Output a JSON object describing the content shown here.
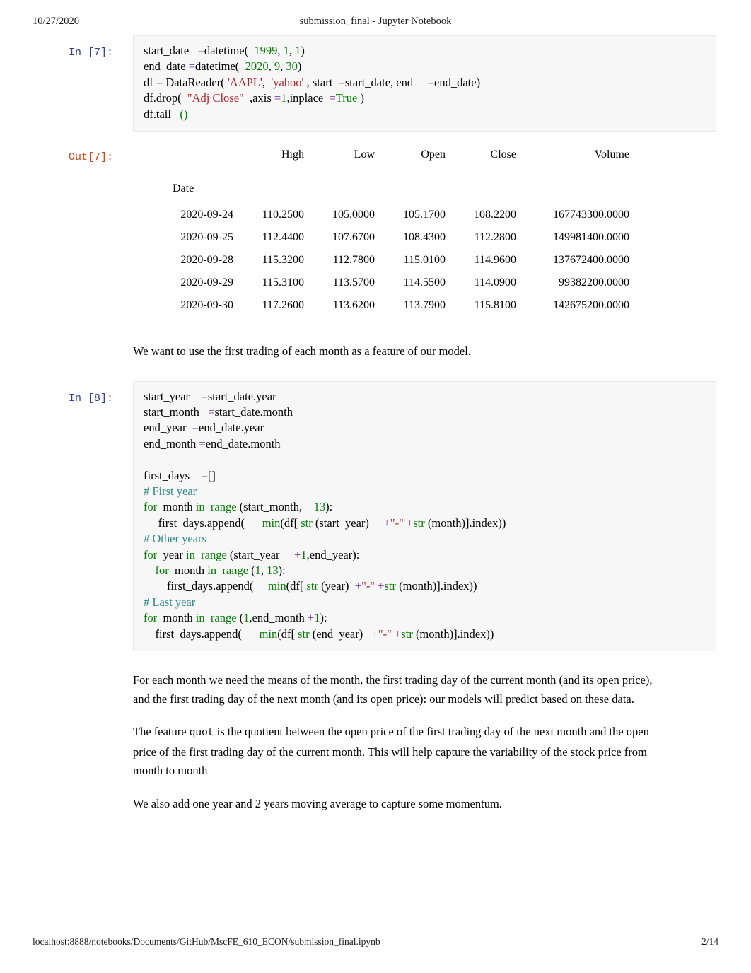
{
  "header": {
    "date": "10/27/2020",
    "title": "submission_final - Jupyter Notebook"
  },
  "footer": {
    "url": "localhost:8888/notebooks/Documents/GitHub/MscFE_610_ECON/submission_final.ipynb",
    "page": "2/14"
  },
  "colors": {
    "prompt_in": "#303f9f",
    "prompt_out": "#d84315",
    "keyword": "#008000",
    "string": "#ba2121",
    "number": "#008000",
    "operator": "#7a3fa0",
    "comment": "#2e8b8b",
    "cell_background": "#f7f7f7",
    "cell_border": "#e7e7e7"
  },
  "cells": [
    {
      "prompt": "In [7]:",
      "type": "code",
      "lines": [
        [
          {
            "t": "start_date",
            "c": "n"
          },
          {
            "t": "   ",
            "c": "n"
          },
          {
            "t": "=",
            "c": "op"
          },
          {
            "t": "datetime(",
            "c": "n"
          },
          {
            "t": "  ",
            "c": "n"
          },
          {
            "t": "1999",
            "c": "m"
          },
          {
            "t": ", ",
            "c": "n"
          },
          {
            "t": "1",
            "c": "m"
          },
          {
            "t": ", ",
            "c": "n"
          },
          {
            "t": "1",
            "c": "m"
          },
          {
            "t": ")",
            "c": "n"
          }
        ],
        [
          {
            "t": "end_date ",
            "c": "n"
          },
          {
            "t": "=",
            "c": "op"
          },
          {
            "t": "datetime(",
            "c": "n"
          },
          {
            "t": "  ",
            "c": "n"
          },
          {
            "t": "2020",
            "c": "m"
          },
          {
            "t": ", ",
            "c": "n"
          },
          {
            "t": "9",
            "c": "m"
          },
          {
            "t": ", ",
            "c": "n"
          },
          {
            "t": "30",
            "c": "m"
          },
          {
            "t": ")",
            "c": "n"
          }
        ],
        [
          {
            "t": "df ",
            "c": "n"
          },
          {
            "t": "=",
            "c": "op"
          },
          {
            "t": " DataReader( ",
            "c": "n"
          },
          {
            "t": "'AAPL'",
            "c": "s"
          },
          {
            "t": ",  ",
            "c": "n"
          },
          {
            "t": "'yahoo'",
            "c": "s"
          },
          {
            "t": " , start  ",
            "c": "n"
          },
          {
            "t": "=",
            "c": "op"
          },
          {
            "t": "start_date, end     ",
            "c": "n"
          },
          {
            "t": "=",
            "c": "op"
          },
          {
            "t": "end_date)",
            "c": "n"
          }
        ],
        [
          {
            "t": "df.drop(  ",
            "c": "n"
          },
          {
            "t": "\"Adj Close\"",
            "c": "s"
          },
          {
            "t": "  ,axis ",
            "c": "n"
          },
          {
            "t": "=",
            "c": "op"
          },
          {
            "t": "1",
            "c": "m"
          },
          {
            "t": ",inplace  ",
            "c": "n"
          },
          {
            "t": "=",
            "c": "op"
          },
          {
            "t": "True",
            "c": "bp"
          },
          {
            "t": " )",
            "c": "n"
          }
        ],
        [
          {
            "t": "df.tail",
            "c": "n"
          },
          {
            "t": "   ",
            "c": "n"
          },
          {
            "t": "()",
            "c": "m"
          }
        ]
      ]
    }
  ],
  "output": {
    "prompt": "Out[7]:",
    "table": {
      "index_name": "Date",
      "columns": [
        "High",
        "Low",
        "Open",
        "Close",
        "Volume"
      ],
      "rows": [
        {
          "date": "2020-09-24",
          "values": [
            "110.2500",
            "105.0000",
            "105.1700",
            "108.2200",
            "167743300.0000"
          ]
        },
        {
          "date": "2020-09-25",
          "values": [
            "112.4400",
            "107.6700",
            "108.4300",
            "112.2800",
            "149981400.0000"
          ]
        },
        {
          "date": "2020-09-28",
          "values": [
            "115.3200",
            "112.7800",
            "115.0100",
            "114.9600",
            "137672400.0000"
          ]
        },
        {
          "date": "2020-09-29",
          "values": [
            "115.3100",
            "113.5700",
            "114.5500",
            "114.0900",
            "99382200.0000"
          ]
        },
        {
          "date": "2020-09-30",
          "values": [
            "117.2600",
            "113.6200",
            "113.7900",
            "115.8100",
            "142675200.0000"
          ]
        }
      ]
    }
  },
  "markdown_1": {
    "paragraphs": [
      "We want to use the first trading of each month as a feature of our model."
    ]
  },
  "cell2": {
    "prompt": "In [8]:",
    "lines": [
      [
        {
          "t": "start_year",
          "c": "n"
        },
        {
          "t": "    ",
          "c": "n"
        },
        {
          "t": "=",
          "c": "op"
        },
        {
          "t": "start_date.year",
          "c": "n"
        }
      ],
      [
        {
          "t": "start_month",
          "c": "n"
        },
        {
          "t": "   ",
          "c": "n"
        },
        {
          "t": "=",
          "c": "op"
        },
        {
          "t": "start_date.month",
          "c": "n"
        }
      ],
      [
        {
          "t": "end_year ",
          "c": "n"
        },
        {
          "t": " ",
          "c": "n"
        },
        {
          "t": "=",
          "c": "op"
        },
        {
          "t": "end_date.year",
          "c": "n"
        }
      ],
      [
        {
          "t": "end_month ",
          "c": "n"
        },
        {
          "t": "=",
          "c": "op"
        },
        {
          "t": "end_date.month",
          "c": "n"
        }
      ],
      [],
      [
        {
          "t": "first_days",
          "c": "n"
        },
        {
          "t": "    ",
          "c": "n"
        },
        {
          "t": "=",
          "c": "op"
        },
        {
          "t": "[]",
          "c": "n"
        }
      ],
      [
        {
          "t": "# First year",
          "c": "c"
        }
      ],
      [
        {
          "t": "for",
          "c": "k"
        },
        {
          "t": "  month ",
          "c": "n"
        },
        {
          "t": "in",
          "c": "k"
        },
        {
          "t": "  ",
          "c": "n"
        },
        {
          "t": "range",
          "c": "nb"
        },
        {
          "t": " (start_month,",
          "c": "n"
        },
        {
          "t": "    ",
          "c": "n"
        },
        {
          "t": "13",
          "c": "m"
        },
        {
          "t": "):",
          "c": "n"
        }
      ],
      [
        {
          "t": "     first_days.append(",
          "c": "n"
        },
        {
          "t": "      ",
          "c": "n"
        },
        {
          "t": "min",
          "c": "nb"
        },
        {
          "t": "(df[ ",
          "c": "n"
        },
        {
          "t": "str",
          "c": "nb"
        },
        {
          "t": " (start_year)",
          "c": "n"
        },
        {
          "t": "     ",
          "c": "n"
        },
        {
          "t": "+",
          "c": "op"
        },
        {
          "t": "\"-\"",
          "c": "s"
        },
        {
          "t": " ",
          "c": "n"
        },
        {
          "t": "+",
          "c": "op"
        },
        {
          "t": "str",
          "c": "nb"
        },
        {
          "t": " (month)].index))",
          "c": "n"
        }
      ],
      [
        {
          "t": "# Other years",
          "c": "c"
        }
      ],
      [
        {
          "t": "for",
          "c": "k"
        },
        {
          "t": "  year ",
          "c": "n"
        },
        {
          "t": "in",
          "c": "k"
        },
        {
          "t": "  ",
          "c": "n"
        },
        {
          "t": "range",
          "c": "nb"
        },
        {
          "t": " (start_year",
          "c": "n"
        },
        {
          "t": "     ",
          "c": "n"
        },
        {
          "t": "+",
          "c": "op"
        },
        {
          "t": "1",
          "c": "m"
        },
        {
          "t": ",end_year):",
          "c": "n"
        }
      ],
      [
        {
          "t": "    ",
          "c": "n"
        },
        {
          "t": "for",
          "c": "k"
        },
        {
          "t": "  month ",
          "c": "n"
        },
        {
          "t": "in",
          "c": "k"
        },
        {
          "t": "  ",
          "c": "n"
        },
        {
          "t": "range",
          "c": "nb"
        },
        {
          "t": " (",
          "c": "n"
        },
        {
          "t": "1",
          "c": "m"
        },
        {
          "t": ", ",
          "c": "n"
        },
        {
          "t": "13",
          "c": "m"
        },
        {
          "t": "):",
          "c": "n"
        }
      ],
      [
        {
          "t": "        first_days.append(",
          "c": "n"
        },
        {
          "t": "     ",
          "c": "n"
        },
        {
          "t": "min",
          "c": "nb"
        },
        {
          "t": "(df[ ",
          "c": "n"
        },
        {
          "t": "str",
          "c": "nb"
        },
        {
          "t": " (year)",
          "c": "n"
        },
        {
          "t": "  ",
          "c": "n"
        },
        {
          "t": "+",
          "c": "op"
        },
        {
          "t": "\"-\"",
          "c": "s"
        },
        {
          "t": " ",
          "c": "n"
        },
        {
          "t": "+",
          "c": "op"
        },
        {
          "t": "str",
          "c": "nb"
        },
        {
          "t": " (month)].index))",
          "c": "n"
        }
      ],
      [
        {
          "t": "# Last year",
          "c": "c"
        }
      ],
      [
        {
          "t": "for",
          "c": "k"
        },
        {
          "t": "  month ",
          "c": "n"
        },
        {
          "t": "in",
          "c": "k"
        },
        {
          "t": "  ",
          "c": "n"
        },
        {
          "t": "range",
          "c": "nb"
        },
        {
          "t": " (",
          "c": "n"
        },
        {
          "t": "1",
          "c": "m"
        },
        {
          "t": ",end_month ",
          "c": "n"
        },
        {
          "t": "+",
          "c": "op"
        },
        {
          "t": "1",
          "c": "m"
        },
        {
          "t": "):",
          "c": "n"
        }
      ],
      [
        {
          "t": "    first_days.append(",
          "c": "n"
        },
        {
          "t": "      ",
          "c": "n"
        },
        {
          "t": "min",
          "c": "nb"
        },
        {
          "t": "(df[ ",
          "c": "n"
        },
        {
          "t": "str",
          "c": "nb"
        },
        {
          "t": " (end_year)",
          "c": "n"
        },
        {
          "t": "   ",
          "c": "n"
        },
        {
          "t": "+",
          "c": "op"
        },
        {
          "t": "\"-\"",
          "c": "s"
        },
        {
          "t": " ",
          "c": "n"
        },
        {
          "t": "+",
          "c": "op"
        },
        {
          "t": "str",
          "c": "nb"
        },
        {
          "t": " (month)].index))",
          "c": "n"
        }
      ]
    ]
  },
  "markdown_2": {
    "paragraphs": [
      "For each month we need the means of the month, the first trading day of the current month (and its open price), and the first trading day of the next month (and its open price): our models will predict based on these data.",
      "We also add one year and 2 years moving average to capture some momentum."
    ],
    "feature_paragraph": {
      "before": "The feature",
      "code": "quot",
      "after": "is the quotient between the open price of the first trading day of the next month and the open price of the first trading day of the current month. This will help capture the variability of the stock price from month to month"
    }
  }
}
